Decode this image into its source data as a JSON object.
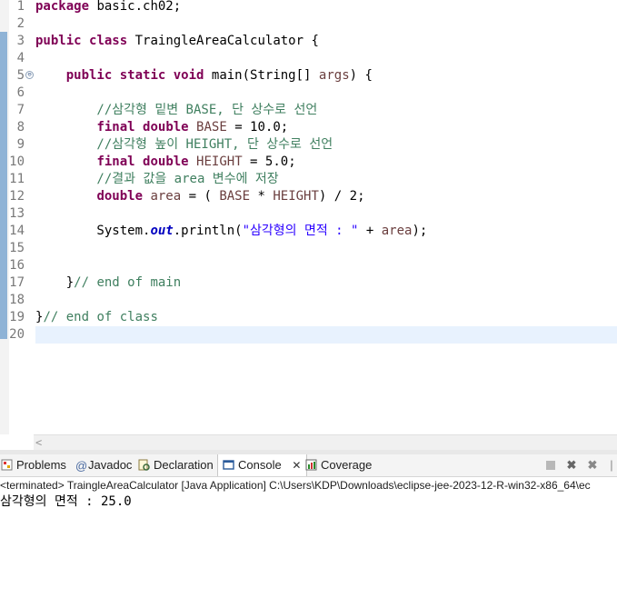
{
  "editor": {
    "line_numbers": [
      "1",
      "2",
      "3",
      "4",
      "5",
      "6",
      "7",
      "8",
      "9",
      "10",
      "11",
      "12",
      "13",
      "14",
      "15",
      "16",
      "17",
      "18",
      "19",
      "20"
    ],
    "fold_marker": "⊖",
    "code": {
      "l1_kw": "package",
      "l1_rest": " basic.ch02;",
      "l3_kw1": "public",
      "l3_kw2": "class",
      "l3_rest": " TraingleAreaCalculator {",
      "l5_indent": "    ",
      "l5_kw1": "public",
      "l5_kw2": "static",
      "l5_kw3": "void",
      "l5_mid": " main(String[] ",
      "l5_var": "args",
      "l5_end": ") {",
      "l7_cm": "        //삼각형 밑변 BASE, 단 상수로 선언",
      "l8_indent": "        ",
      "l8_kw1": "final",
      "l8_kw2": "double",
      "l8_var": "BASE",
      "l8_rest": " = 10.0;",
      "l9_cm": "        //삼각형 높이 HEIGHT, 단 상수로 선언",
      "l10_indent": "        ",
      "l10_kw1": "final",
      "l10_kw2": "double",
      "l10_var": "HEIGHT",
      "l10_rest": " = 5.0;",
      "l11_cm": "        //결과 값을 area 변수에 저장",
      "l12_indent": "        ",
      "l12_kw": "double",
      "l12_var1": "area",
      "l12_mid1": " = ( ",
      "l12_var2": "BASE",
      "l12_mid2": " * ",
      "l12_var3": "HEIGHT",
      "l12_end": ") / 2;",
      "l14_start": "        System.",
      "l14_field": "out",
      "l14_mid": ".println(",
      "l14_str": "\"삼각형의 면적 : \"",
      "l14_plus": " + ",
      "l14_var": "area",
      "l14_end": ");",
      "l17_brace": "    }",
      "l17_cm": "// end of main",
      "l19_brace": "}",
      "l19_cm": "// end of class"
    }
  },
  "hscroll": {
    "left_arrow": "<"
  },
  "bottom_panel": {
    "tabs": [
      "Problems",
      "Javadoc",
      "Declaration",
      "Console",
      "Coverage"
    ],
    "active_tab": "Console",
    "close_glyph": "✕",
    "toolbar_icons": [
      "terminate-icon",
      "remove-launch-icon",
      "remove-all-terminated-icon"
    ],
    "status": "<terminated> TraingleAreaCalculator [Java Application] C:\\Users\\KDP\\Downloads\\eclipse-jee-2023-12-R-win32-x86_64\\ec",
    "output": "삼각형의 면적 : 25.0"
  }
}
